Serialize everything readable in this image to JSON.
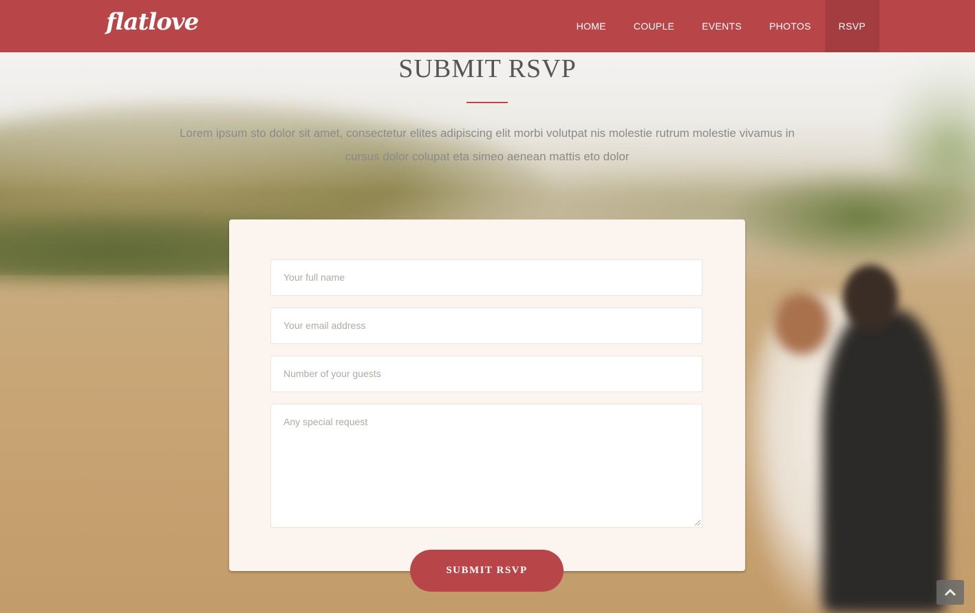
{
  "brand": {
    "logo": "flatlove"
  },
  "nav": {
    "items": [
      {
        "label": "HOME"
      },
      {
        "label": "COUPLE"
      },
      {
        "label": "EVENTS"
      },
      {
        "label": "PHOTOS"
      },
      {
        "label": "RSVP",
        "active": true
      }
    ]
  },
  "section": {
    "title": "SUBMIT RSVP",
    "lead": "Lorem ipsum sto dolor sit amet, consectetur elites adipiscing elit morbi volutpat nis molestie rutrum molestie vivamus in cursus dolor colupat eta simeo aenean mattis eto dolor"
  },
  "form": {
    "name_placeholder": "Your full name",
    "email_placeholder": "Your email address",
    "guests_placeholder": "Number of your guests",
    "request_placeholder": "Any special request",
    "submit_label": "SUBMIT RSVP"
  },
  "icons": {
    "back_to_top": "chevron-up-icon"
  },
  "colors": {
    "accent": "#b84648",
    "accent_dark": "#a33d3f",
    "card": "#fbf4ef"
  }
}
